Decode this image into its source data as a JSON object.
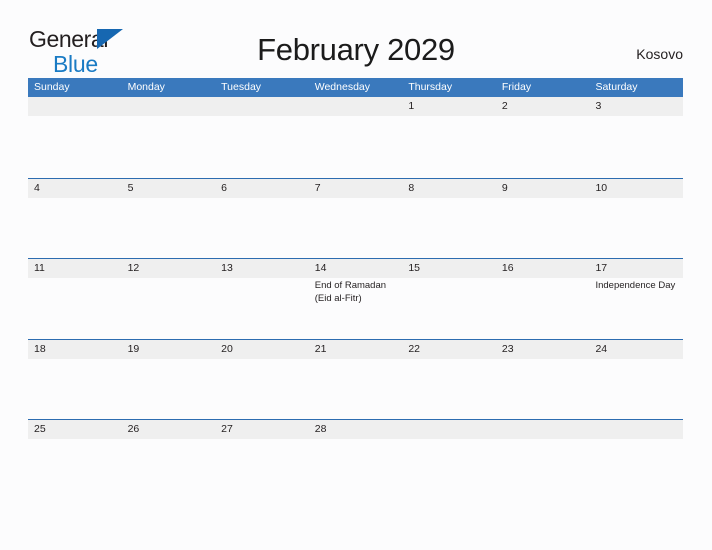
{
  "brand": {
    "name_part1": "General",
    "name_part2": "Blue",
    "flag_icon": "blue-triangle-flag",
    "colors": {
      "part1": "#231f20",
      "part2": "#1a7bc4",
      "flag": "#1667b1"
    }
  },
  "header": {
    "title": "February 2029",
    "locale": "Kosovo"
  },
  "calendar": {
    "colors": {
      "header_band": "#3a79bd",
      "row_rule": "#2c6cb0",
      "date_band": "#efefef",
      "page_background": "#fcfcfd"
    },
    "weekdays": [
      "Sunday",
      "Monday",
      "Tuesday",
      "Wednesday",
      "Thursday",
      "Friday",
      "Saturday"
    ],
    "weeks": [
      [
        {
          "date": "",
          "events": []
        },
        {
          "date": "",
          "events": []
        },
        {
          "date": "",
          "events": []
        },
        {
          "date": "",
          "events": []
        },
        {
          "date": "1",
          "events": []
        },
        {
          "date": "2",
          "events": []
        },
        {
          "date": "3",
          "events": []
        }
      ],
      [
        {
          "date": "4",
          "events": []
        },
        {
          "date": "5",
          "events": []
        },
        {
          "date": "6",
          "events": []
        },
        {
          "date": "7",
          "events": []
        },
        {
          "date": "8",
          "events": []
        },
        {
          "date": "9",
          "events": []
        },
        {
          "date": "10",
          "events": []
        }
      ],
      [
        {
          "date": "11",
          "events": []
        },
        {
          "date": "12",
          "events": []
        },
        {
          "date": "13",
          "events": []
        },
        {
          "date": "14",
          "events": [
            "End of Ramadan (Eid al-Fitr)"
          ]
        },
        {
          "date": "15",
          "events": []
        },
        {
          "date": "16",
          "events": []
        },
        {
          "date": "17",
          "events": [
            "Independence Day"
          ]
        }
      ],
      [
        {
          "date": "18",
          "events": []
        },
        {
          "date": "19",
          "events": []
        },
        {
          "date": "20",
          "events": []
        },
        {
          "date": "21",
          "events": []
        },
        {
          "date": "22",
          "events": []
        },
        {
          "date": "23",
          "events": []
        },
        {
          "date": "24",
          "events": []
        }
      ],
      [
        {
          "date": "25",
          "events": []
        },
        {
          "date": "26",
          "events": []
        },
        {
          "date": "27",
          "events": []
        },
        {
          "date": "28",
          "events": []
        },
        {
          "date": "",
          "events": []
        },
        {
          "date": "",
          "events": []
        },
        {
          "date": "",
          "events": []
        }
      ]
    ]
  }
}
